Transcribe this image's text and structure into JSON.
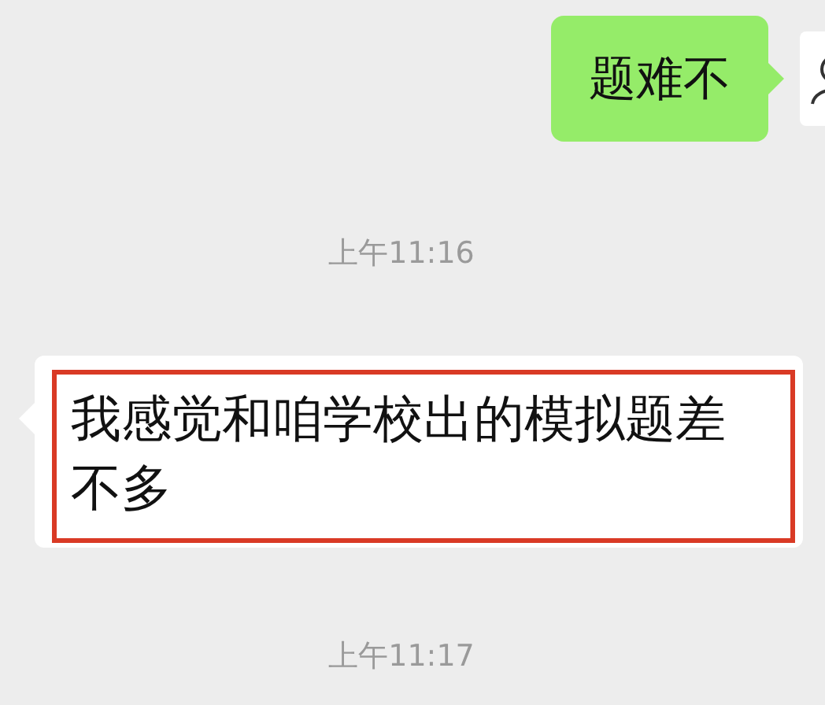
{
  "messages": [
    {
      "kind": "outgoing",
      "text": "题难不"
    },
    {
      "kind": "time",
      "text": "上午11:16"
    },
    {
      "kind": "incoming",
      "text": "我感觉和咱学校出的模拟题差不多",
      "highlighted": true
    },
    {
      "kind": "time",
      "text": "上午11:17"
    }
  ]
}
